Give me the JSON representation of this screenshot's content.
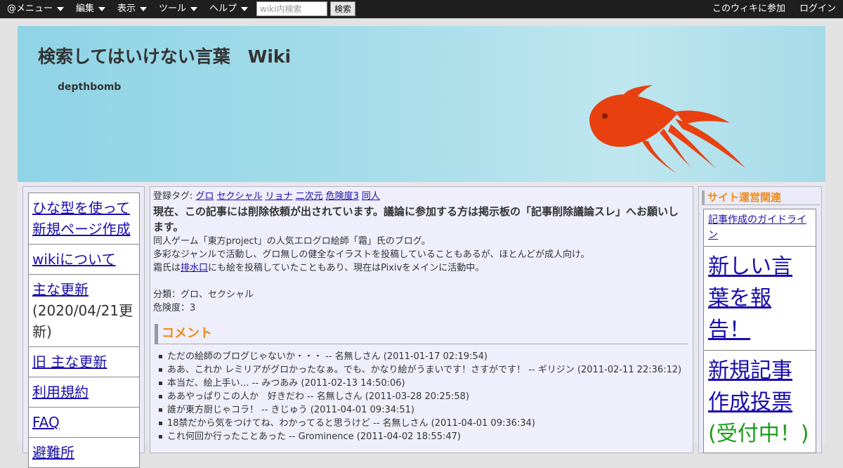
{
  "topbar": {
    "menus": [
      "@メニュー",
      "編集",
      "表示",
      "ツール",
      "ヘルプ"
    ],
    "search_placeholder": "wiki内検索",
    "search_button": "検索",
    "join": "このウィキに参加",
    "login": "ログイン"
  },
  "header": {
    "title": "検索してはいけない言葉　Wiki",
    "subtitle": "depthbomb"
  },
  "left_nav": {
    "items": [
      {
        "label": "ひな型を使って新規ページ作成"
      },
      {
        "label": "wikiについて"
      },
      {
        "label": "主な更新",
        "note": "(2020/04/21更新)"
      },
      {
        "label": "旧 主な更新"
      },
      {
        "label": "利用規約"
      },
      {
        "label": "FAQ"
      },
      {
        "label": "避難所"
      }
    ]
  },
  "main": {
    "tags_label": "登録タグ:",
    "tags": [
      "グロ",
      "セクシャル",
      "リョナ",
      "二次元",
      "危険度3",
      "同人"
    ],
    "notice": "現在、この記事には削除依頼が出されています。議論に参加する方は掲示板の「記事削除議論スレ」へお願いします。",
    "desc1": "同人ゲーム「東方project」の人気エログロ絵師「霜」氏のブログ。",
    "desc2": "多彩なジャンルで活動し、グロ無しの健全なイラストを投稿していることもあるが、ほとんどが成人向け。",
    "desc3_pre": "霜氏は",
    "desc3_link": "排水口",
    "desc3_post": "にも絵を投稿していたこともあり、現在はPixivをメインに活動中。",
    "category": "分類：グロ、セクシャル",
    "danger": "危険度：3",
    "comment_heading": "コメント",
    "comments": [
      "ただの絵師のブログじゃないか・・・ -- 名無しさん (2011-01-17 02:19:54)",
      "ああ、これか レミリアがグロかったなぁ。でも、かなり絵がうまいです！さすがです！ -- ギリジン (2011-02-11 22:36:12)",
      "本当だ、絵上手い… -- みつあみ (2011-02-13 14:50:06)",
      "ああやっぱりこの人か　好きだわ -- 名無しさん (2011-03-28 20:25:58)",
      "誰が東方厨じゃコラ！ -- きじゅう (2011-04-01 09:34:51)",
      "18禁だから気をつけてね、わかってると思うけど -- 名無しさん (2011-04-01 09:36:34)",
      "これ何回か行ったことあった -- Grominence (2011-04-02 18:55:47)"
    ]
  },
  "right": {
    "heading": "サイト運営関連",
    "item1": "記事作成のガイドライン",
    "item2": "新しい言葉を報告！",
    "item3": "新規記事作成投票",
    "item3_status": "(受付中！)"
  },
  "colors": {
    "topbar": "#1f1f1f",
    "accent_orange": "#f08a1a",
    "fish": "#e8400f",
    "header_bg": "#a6dde9"
  }
}
